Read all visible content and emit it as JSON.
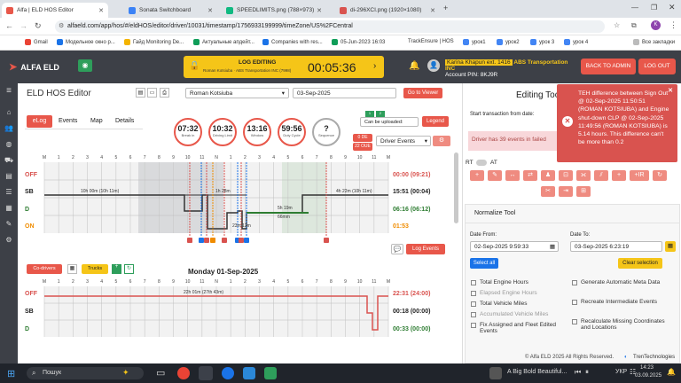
{
  "browser": {
    "tabs": [
      {
        "title": "Alfa | ELD HOS Editor",
        "active": true,
        "color": "#e8574a"
      },
      {
        "title": "Sonata Switchboard",
        "active": false,
        "color": "#3b82f6"
      },
      {
        "title": "SPEEDLIMITS.png (788×973)",
        "active": false,
        "color": "#10b981"
      },
      {
        "title": "di-296XCI.png (1920×1080)",
        "active": false,
        "color": "#d9534f"
      }
    ],
    "url": "alfaeld.com/app/hos/#/eldHOS/editor/driver/10031/timestamp/1756933199999/timeZone/US%2FCentral",
    "bookmarks": [
      "Gmail",
      "Модельное окно р...",
      "Гайд Monitoring De...",
      "Актуальные апдейт...",
      "Companies with res...",
      "05-Jun-2023 16:03",
      "TrackEnsure | HOS",
      "урок1",
      "урок2",
      "урок 3",
      "урок 4",
      "Все закладки"
    ]
  },
  "app": {
    "logo": "ALFA ELD",
    "log_editing": {
      "title": "LOG EDITING",
      "sub": "Roman Kotsiuba · ABS Transportation INC (7998)",
      "timer": "00:05:36"
    },
    "company": {
      "name_prefix": "Karina Khapun ext. 1416",
      "company": "ABS Transportation INC",
      "account_pin": "Account PIN: 8KJ9R"
    },
    "buttons": {
      "back_to_admin": "BACK TO ADMIN",
      "logout": "LOG OUT"
    }
  },
  "editor": {
    "title": "ELD HOS Editor",
    "driver": "Roman Kotsiuba",
    "date": "03-Sep-2025",
    "go_to_viewer": "Go to Viewer",
    "tabs": [
      "eLog",
      "Events",
      "Map",
      "Details"
    ],
    "clocks": [
      {
        "value": "07:32",
        "label": "Break in"
      },
      {
        "value": "10:32",
        "label": "Driving Limit"
      },
      {
        "value": "13:16",
        "label": "Window"
      },
      {
        "value": "59:56",
        "label": "Duty Cycle"
      },
      {
        "value": "?",
        "label": "Sequence"
      }
    ],
    "can_be_uploaded": "Can be uploaded:",
    "legend": "Legend",
    "badges": [
      "0 DE",
      "22 OUE"
    ],
    "driver_events": "Driver Events",
    "day1": {
      "totals": [
        {
          "row": "OFF",
          "value": "00:00 (09:21)",
          "color": "#d9534f"
        },
        {
          "row": "SB",
          "value": "15:51 (00:04)",
          "color": "#222"
        },
        {
          "row": "D",
          "value": "06:16 (06:12)",
          "color": "#2e7d32"
        },
        {
          "row": "ON",
          "value": "01:53",
          "color": "#f08c00"
        }
      ],
      "annotations": {
        "sb1": "10h 00m (10h 11m)",
        "sb2": "4h 22m (10h 11m)",
        "sb3": "1h 28m",
        "d1": "5h 19m",
        "d2": "66mm",
        "on1": "23m 12m"
      },
      "log_events": "Log Events"
    },
    "toolbar2": {
      "codrivers": "Co-drivers",
      "trucks": "Trucks"
    },
    "day2": {
      "title": "Monday 01-Sep-2025",
      "totals": [
        {
          "row": "OFF",
          "value": "22:31 (24:00)",
          "color": "#d9534f"
        },
        {
          "row": "SB",
          "value": "00:18 (00:00)",
          "color": "#222"
        },
        {
          "row": "D",
          "value": "00:33 (00:00)",
          "color": "#2e7d32"
        }
      ],
      "annotation": "22h 01m (27th 43m)"
    },
    "hour_labels": [
      "M",
      "1",
      "2",
      "3",
      "4",
      "5",
      "6",
      "7",
      "8",
      "9",
      "10",
      "11",
      "N",
      "1",
      "2",
      "3",
      "4",
      "5",
      "6",
      "7",
      "8",
      "9",
      "10",
      "11",
      "M"
    ]
  },
  "panel": {
    "title": "Editing Tool",
    "start_transaction": "Start transaction from date:",
    "events_failed": "Driver has 39 events in failed",
    "toggle": {
      "rt": "RT",
      "at": "AT"
    },
    "normalize": "Normalize Tool",
    "date_from_label": "Date From:",
    "date_to_label": "Date To:",
    "date_from": "02-Sep-2025 9:59:33",
    "date_to": "03-Sep-2025 6:23:19",
    "select_all": "Select all",
    "clear_selection": "Clear selection",
    "options_left": [
      {
        "label": "Total Engine Hours",
        "disabled": false
      },
      {
        "label": "Elapsed Engine Hours",
        "disabled": true
      },
      {
        "label": "Total Vehicle Miles",
        "disabled": false
      },
      {
        "label": "Accumulated Vehicle Miles",
        "disabled": true
      },
      {
        "label": "Fix Assigned and Fleet Edited Events",
        "disabled": false
      }
    ],
    "options_right": [
      {
        "label": "Generate Automatic Meta Data",
        "disabled": false
      },
      {
        "label": "Recreate Intermediate Events",
        "disabled": false
      },
      {
        "label": "Recalculate Missing Coordinates and Locations",
        "disabled": false
      }
    ]
  },
  "toast": "TEH difference between Sign Out @ 02-Sep-2025 11:50:51 (ROMAN KOTSIUBA) and Engine shut-down CLP @ 02-Sep-2025 11:49:56 (ROMAN KOTSIUBA) is 5.14 hours. This difference can't be more than 0.2",
  "footer": {
    "copyright": "© Alfa ELD   2025 All Rights Reserved.",
    "brand": "TrenTechnologies"
  },
  "taskbar": {
    "search": "Пошук",
    "media": "A Big Bold Beautiful...",
    "lang": "УКР",
    "time": "14:23",
    "date": "03.09.2025"
  }
}
